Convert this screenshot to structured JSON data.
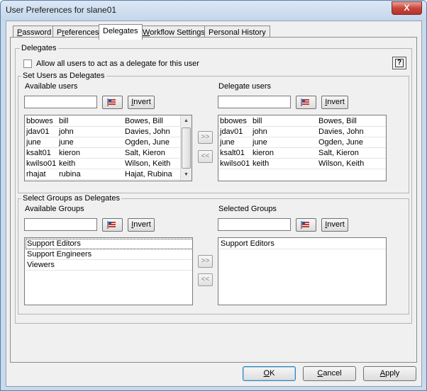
{
  "window": {
    "title": "User Preferences for slane01",
    "close_glyph": "X"
  },
  "tabs": [
    {
      "label": "Password",
      "accel": "P",
      "rest": "assword"
    },
    {
      "label": "Preferences",
      "accel": "r",
      "pre": "P",
      "rest": "eferences"
    },
    {
      "label": "Delegates",
      "accel": "",
      "pre": "Delegates",
      "rest": ""
    },
    {
      "label": "Workflow Settings",
      "accel": "W",
      "rest": "orkflow Settings"
    },
    {
      "label": "Personal History",
      "accel": "",
      "pre": "Personal History",
      "rest": ""
    }
  ],
  "delegates": {
    "legend": "Delegates",
    "allow_all_label": "Allow all users to act as a delegate for this user",
    "allow_all_checked": false,
    "help_glyph": "?"
  },
  "users_section": {
    "legend": "Set Users as Delegates",
    "available_label": "Available users",
    "delegate_label": "Delegate users",
    "available_filter_value": "",
    "delegate_filter_value": "",
    "invert_label": "Invert",
    "invert_accel": "I",
    "invert_rest": "nvert",
    "add_glyph": ">>",
    "remove_glyph": "<<",
    "available_users": [
      [
        "bbowes",
        "bill",
        "Bowes, Bill"
      ],
      [
        "jdav01",
        "john",
        "Davies, John"
      ],
      [
        "june",
        "june",
        "Ogden, June"
      ],
      [
        "ksalt01",
        "kieron",
        "Salt, Kieron"
      ],
      [
        "kwilso01",
        "keith",
        "Wilson, Keith"
      ],
      [
        "rhajat",
        "rubina",
        "Hajat, Rubina"
      ]
    ],
    "delegate_users": [
      [
        "bbowes",
        "bill",
        "Bowes, Bill"
      ],
      [
        "jdav01",
        "john",
        "Davies, John"
      ],
      [
        "june",
        "june",
        "Ogden, June"
      ],
      [
        "ksalt01",
        "kieron",
        "Salt, Kieron"
      ],
      [
        "kwilso01",
        "keith",
        "Wilson, Keith"
      ]
    ]
  },
  "groups_section": {
    "legend": "Select Groups as Delegates",
    "available_label": "Available Groups",
    "selected_label": "Selected Groups",
    "available_filter_value": "",
    "selected_filter_value": "",
    "available_groups": [
      "Support Editors",
      "Support Engineers",
      "Viewers"
    ],
    "selected_groups": [
      "Support Editors"
    ]
  },
  "footer": {
    "ok_label": "OK",
    "ok_accel": "O",
    "ok_rest": "K",
    "cancel_label": "Cancel",
    "cancel_accel": "C",
    "cancel_rest": "ancel",
    "apply_label": "Apply",
    "apply_accel": "A",
    "apply_rest": "pply"
  },
  "colors": {
    "title_bar": "#c9daeb",
    "close_button": "#c9463a",
    "dialog_bg": "#f0f0f0"
  }
}
